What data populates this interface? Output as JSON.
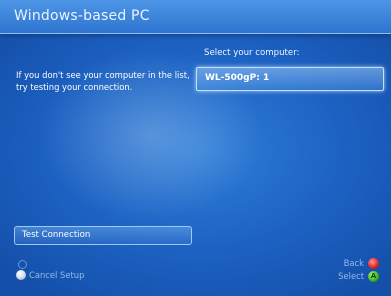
{
  "header": {
    "title": "Windows-based PC"
  },
  "main": {
    "helper_text": "If you don't see your computer in the list, try testing your connection.",
    "select_label": "Select your computer:",
    "computers": [
      {
        "label": "WL-500gP: 1"
      }
    ],
    "test_button_label": "Test Connection"
  },
  "footer": {
    "cancel_label": "Cancel Setup",
    "back_label": "Back",
    "select_label": "Select",
    "a_button_glyph": "A"
  },
  "icons": {
    "guide": "guide-button-icon",
    "cancel": "white-button-icon",
    "back": "b-button-icon",
    "select": "a-button-icon"
  },
  "colors": {
    "background": "#1d62c3",
    "header": "#3b82dc",
    "b_button": "#e02b2b",
    "a_button": "#3fb51e"
  }
}
